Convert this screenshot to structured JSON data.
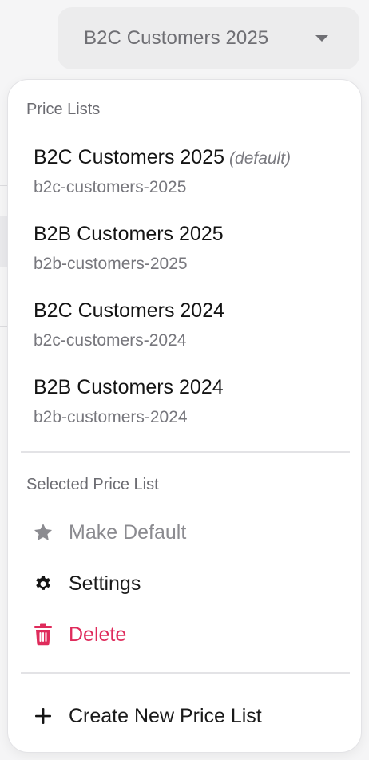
{
  "selector": {
    "label": "B2C Customers 2025"
  },
  "menu": {
    "price_lists_title": "Price Lists",
    "price_lists": [
      {
        "name": "B2C Customers 2025",
        "default_tag": "(default)",
        "slug": "b2c-customers-2025"
      },
      {
        "name": "B2B Customers 2025",
        "slug": "b2b-customers-2025"
      },
      {
        "name": "B2C Customers 2024",
        "slug": "b2c-customers-2024"
      },
      {
        "name": "B2B Customers 2024",
        "slug": "b2b-customers-2024"
      }
    ],
    "selected_title": "Selected Price List",
    "actions": {
      "make_default": "Make Default",
      "settings": "Settings",
      "delete": "Delete"
    },
    "create_label": "Create New Price List"
  },
  "colors": {
    "danger": "#df2b5b",
    "muted": "#8b8b90"
  }
}
